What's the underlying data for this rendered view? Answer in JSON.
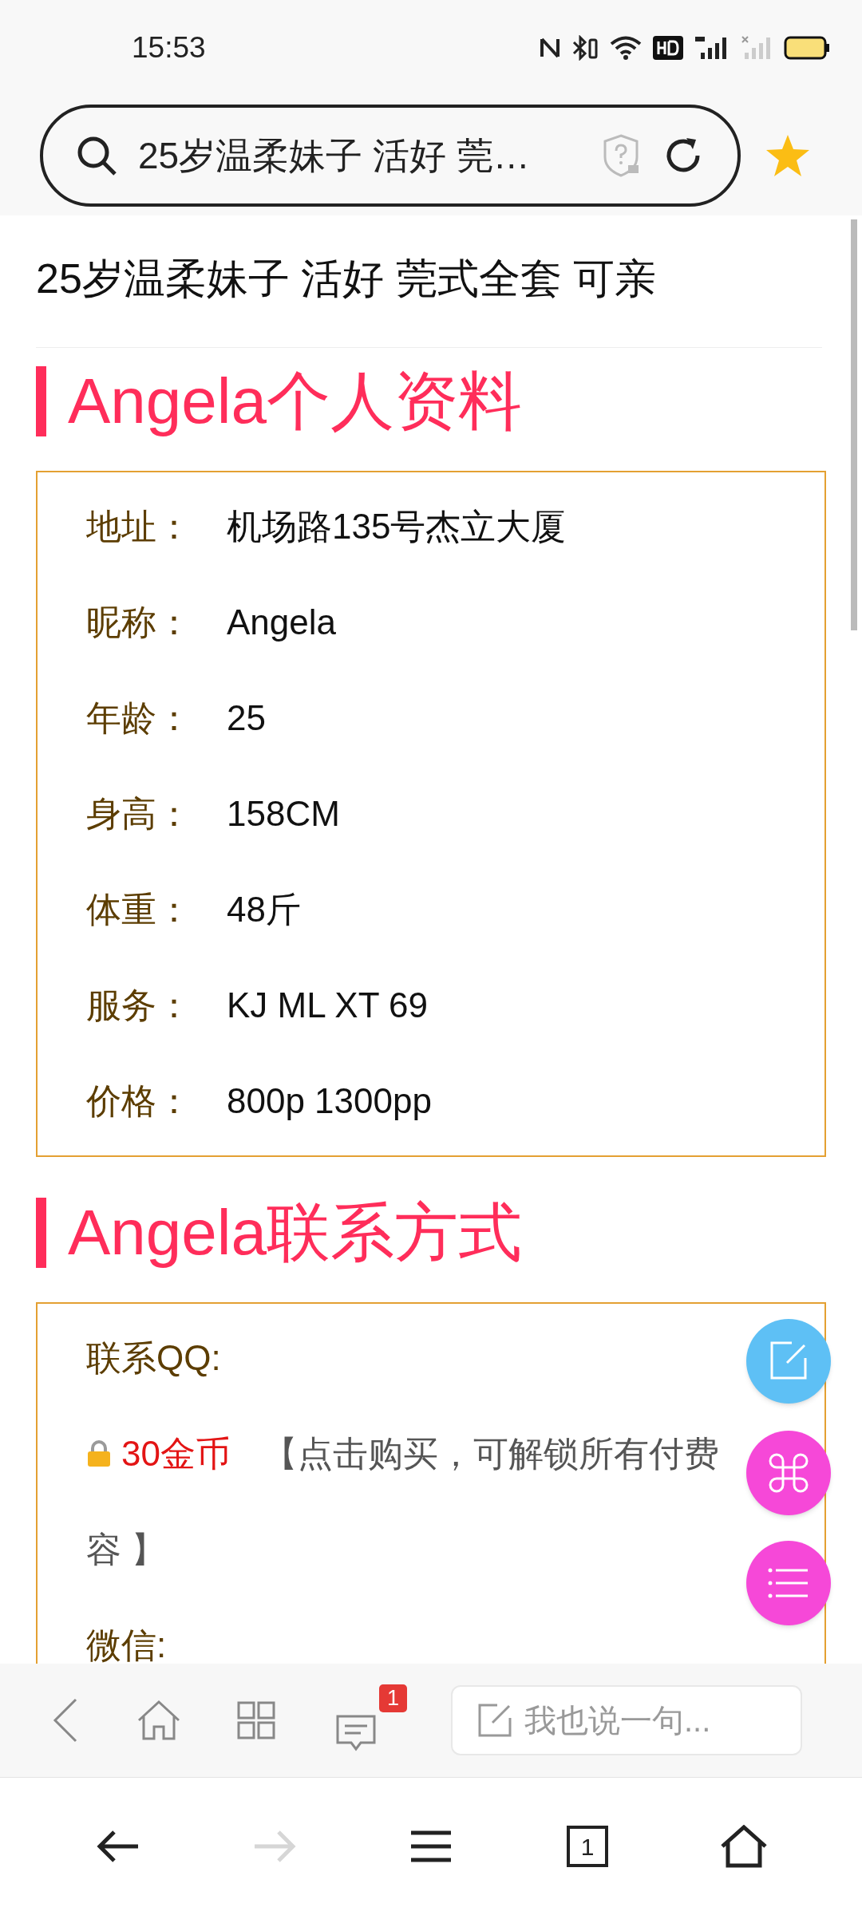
{
  "status_bar": {
    "time": "15:53"
  },
  "address_bar": {
    "text": "25岁温柔妹子 活好 莞…"
  },
  "page": {
    "title": "25岁温柔妹子 活好 莞式全套 可亲",
    "sections": [
      {
        "heading": "Angela个人资料",
        "rows": [
          {
            "kind": "field",
            "label": "地址：",
            "value": "机场路135号杰立大厦"
          },
          {
            "kind": "field",
            "label": "昵称：",
            "value": "Angela"
          },
          {
            "kind": "field",
            "label": "年龄：",
            "value": "25"
          },
          {
            "kind": "field",
            "label": "身高：",
            "value": "158CM"
          },
          {
            "kind": "field",
            "label": "体重：",
            "value": "48斤"
          },
          {
            "kind": "field",
            "label": "服务：",
            "value": "KJ ML XT 69"
          },
          {
            "kind": "field",
            "label": "价格：",
            "value": "800p 1300pp"
          }
        ]
      },
      {
        "heading": "Angela联系方式",
        "rows": [
          {
            "kind": "label",
            "text": "联系QQ:"
          },
          {
            "kind": "locked",
            "price": "30金币",
            "text": "【点击购买，可解锁所有付费"
          },
          {
            "kind": "plain",
            "text": "容 】"
          },
          {
            "kind": "label",
            "text": "微信:"
          }
        ]
      }
    ]
  },
  "comment_bar": {
    "badge": "1",
    "placeholder": "我也说一句..."
  },
  "nav": {
    "buttons": [
      {
        "kind": "back",
        "disabled": false
      },
      {
        "kind": "forward",
        "disabled": true
      },
      {
        "kind": "menu",
        "disabled": false
      },
      {
        "kind": "tabs",
        "count": "1",
        "disabled": false
      },
      {
        "kind": "home",
        "disabled": false
      }
    ]
  }
}
